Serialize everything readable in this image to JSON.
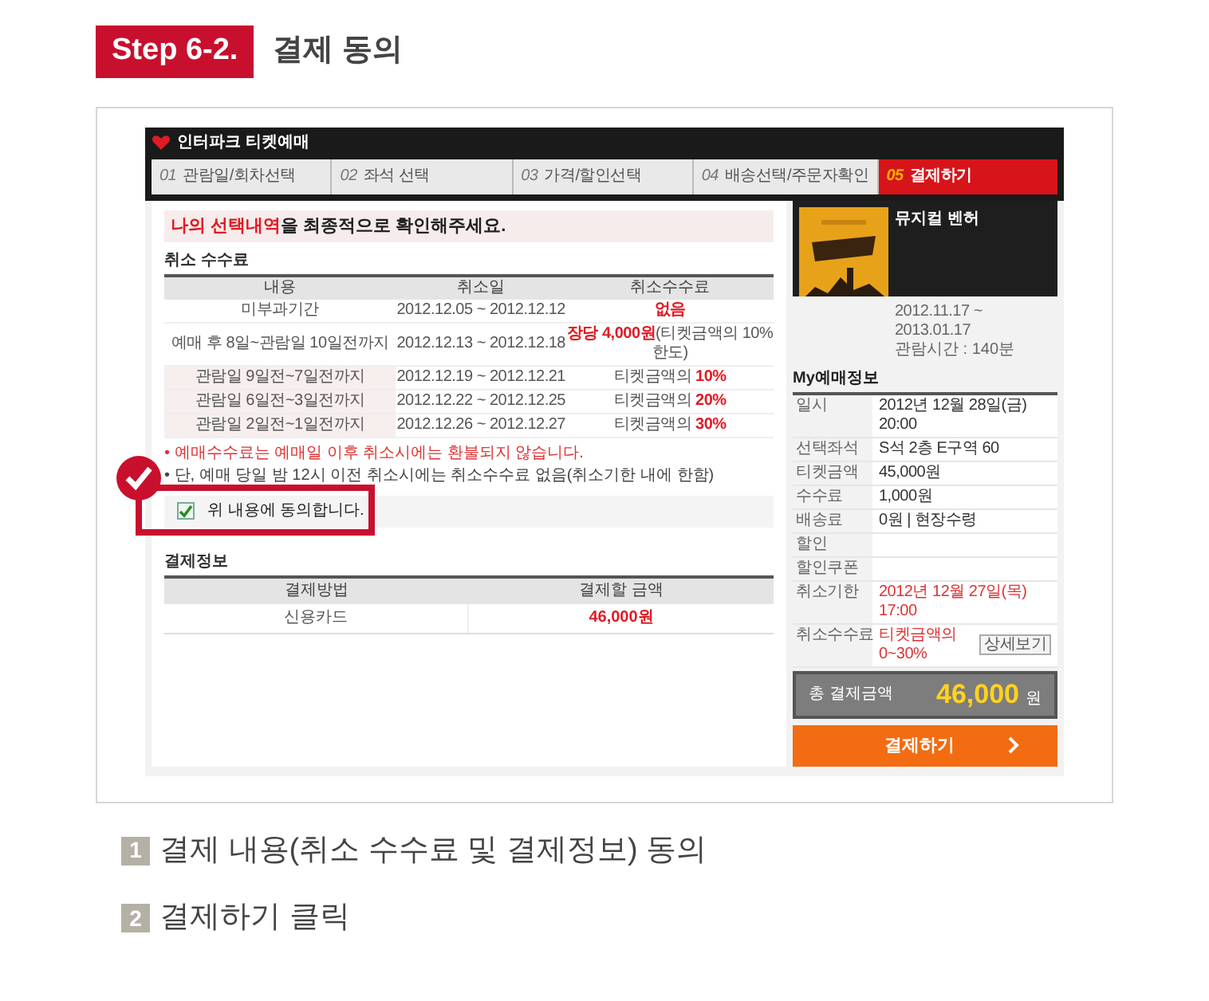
{
  "step_badge": "Step 6-2.",
  "title": "결제 동의",
  "app": {
    "brand": "인터파크 티켓예매",
    "steps": [
      {
        "number": "01",
        "label": "관람일/회차선택",
        "selected": false
      },
      {
        "number": "02",
        "label": "좌석 선택",
        "selected": false
      },
      {
        "number": "03",
        "label": "가격/할인선택",
        "selected": false
      },
      {
        "number": "04",
        "label": "배송선택/주문자확인",
        "selected": false
      },
      {
        "number": "05",
        "label": "결제하기",
        "selected": true
      }
    ],
    "heading_highlight": "나의 선택내역",
    "heading_rest": "을 최종적으로 확인해주세요.",
    "cancel_section": "취소 수수료",
    "cancel_columns": [
      "내용",
      "취소일",
      "취소수수료"
    ],
    "cancel_rows": [
      {
        "content": "미부과기간",
        "date": "2012.12.05 ~ 2012.12.12",
        "fee": [
          {
            "text": "없음",
            "emphasis": true
          }
        ]
      },
      {
        "content": "예매 후 8일~관람일 10일전까지",
        "date": "2012.12.13 ~ 2012.12.18",
        "fee": [
          {
            "text": "장당 4,000원",
            "emphasis": true
          },
          {
            "text": "(티켓금액의 10%한도)",
            "emphasis": false
          }
        ]
      },
      {
        "content": "관람일 9일전~7일전까지",
        "date": "2012.12.19 ~ 2012.12.21",
        "fee": [
          {
            "text": "티켓금액의 ",
            "emphasis": false
          },
          {
            "text": "10%",
            "emphasis": true
          }
        ]
      },
      {
        "content": "관람일 6일전~3일전까지",
        "date": "2012.12.22 ~ 2012.12.25",
        "fee": [
          {
            "text": "티켓금액의 ",
            "emphasis": false
          },
          {
            "text": "20%",
            "emphasis": true
          }
        ]
      },
      {
        "content": "관람일 2일전~1일전까지",
        "date": "2012.12.26 ~ 2012.12.27",
        "fee": [
          {
            "text": "티켓금액의 ",
            "emphasis": false
          },
          {
            "text": "30%",
            "emphasis": true
          }
        ]
      }
    ],
    "notes": [
      {
        "text": "• 예매수수료는 예매일 이후 취소시에는 환불되지 않습니다.",
        "emphasis": true
      },
      {
        "text": "• 단, 예매 당일 밤 12시 이전 취소시에는 취소수수료 없음(취소기한 내에 한함)",
        "emphasis": false
      }
    ],
    "agree": {
      "label": "위 내용에 동의합니다.",
      "checked": true
    },
    "payment_section": "결제정보",
    "payment_columns": [
      "결제방법",
      "결제할 금액"
    ],
    "payment_row": {
      "method": "신용카드",
      "amount": "46,000원"
    },
    "sidebar": {
      "title": "뮤지컬 벤허",
      "period": "2012.11.17 ~ 2013.01.17",
      "running_time": "관람시간 : 140분",
      "my_title": "My예매정보",
      "info": [
        {
          "label": "일시",
          "value": "2012년 12월 28일(금) 20:00",
          "emphasis": false
        },
        {
          "label": "선택좌석",
          "value": "S석 2층 E구역 60",
          "emphasis": false
        },
        {
          "label": "티켓금액",
          "value": "45,000원",
          "emphasis": false
        },
        {
          "label": "수수료",
          "value": "1,000원",
          "emphasis": false
        },
        {
          "label": "배송료",
          "value": "0원 | 현장수령",
          "emphasis": false
        },
        {
          "label": "할인"
        },
        {
          "label": "할인쿠폰"
        },
        {
          "label": "취소기한",
          "value": "2012년 12월 27일(목) 17:00",
          "emphasis": true
        },
        {
          "label": "취소수수료",
          "value": "티켓금액의 0~30%",
          "emphasis": true,
          "button": "상세보기"
        }
      ],
      "total_label": "총 결제금액",
      "total_amount": "46,000",
      "total_unit": "원",
      "pay_button": "결제하기"
    }
  },
  "instructions": [
    {
      "number": "1",
      "text": "결제 내용(취소 수수료 및 결제정보) 동의"
    },
    {
      "number": "2",
      "text": "결제하기 클릭"
    }
  ]
}
